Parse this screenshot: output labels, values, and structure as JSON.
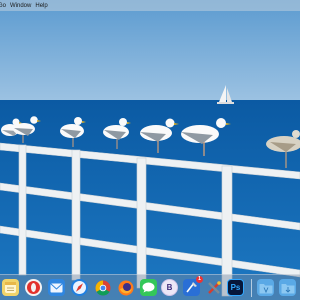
{
  "menubar": {
    "items": [
      "Go",
      "Window",
      "Help"
    ]
  },
  "wallpaper": {
    "description_icon": "seagulls-on-railing",
    "sky_color": "#5f9fd3",
    "sea_color": "#0a5fa9"
  },
  "dock": {
    "apps": [
      {
        "name": "Notes",
        "icon": "notes-icon"
      },
      {
        "name": "Opera",
        "icon": "opera-icon"
      },
      {
        "name": "Mail",
        "icon": "mail-icon"
      },
      {
        "name": "Safari",
        "icon": "safari-icon"
      },
      {
        "name": "Chrome",
        "icon": "chrome-icon"
      },
      {
        "name": "Firefox",
        "icon": "firefox-icon"
      },
      {
        "name": "Messages",
        "icon": "messages-icon"
      },
      {
        "name": "B",
        "icon": "b-app-icon"
      },
      {
        "name": "Xcode",
        "icon": "xcode-icon",
        "badge": "1"
      },
      {
        "name": "Tools",
        "icon": "tools-icon"
      },
      {
        "name": "Ps",
        "icon": "photoshop-icon"
      },
      {
        "name": "Applications",
        "icon": "applications-folder-icon"
      },
      {
        "name": "Downloads",
        "icon": "downloads-folder-icon"
      }
    ],
    "labels": {
      "b_app": "B",
      "photoshop": "Ps",
      "xcode_badge": "1"
    }
  }
}
